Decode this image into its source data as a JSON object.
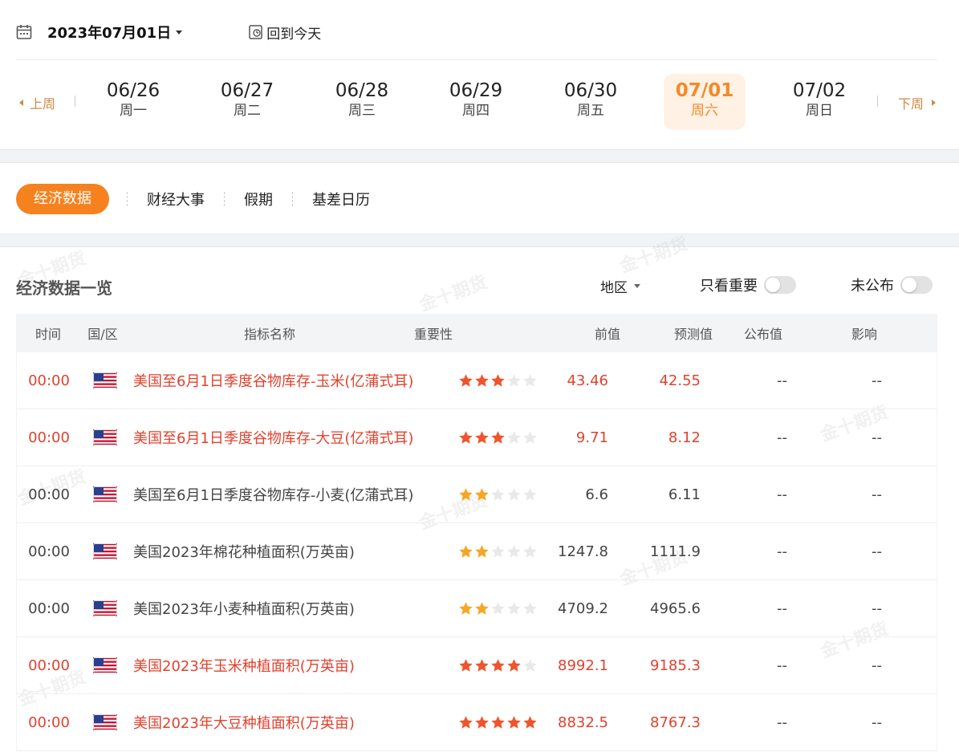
{
  "header": {
    "date": "2023年07月01日",
    "today_label": "回到今天"
  },
  "week": {
    "prev_label": "上周",
    "next_label": "下周",
    "days": [
      {
        "date": "06/26",
        "weekday": "周一"
      },
      {
        "date": "06/27",
        "weekday": "周二"
      },
      {
        "date": "06/28",
        "weekday": "周三"
      },
      {
        "date": "06/29",
        "weekday": "周四"
      },
      {
        "date": "06/30",
        "weekday": "周五"
      },
      {
        "date": "07/01",
        "weekday": "周六"
      },
      {
        "date": "07/02",
        "weekday": "周日"
      }
    ],
    "active_index": 5
  },
  "tabs": [
    "经济数据",
    "财经大事",
    "假期",
    "基差日历"
  ],
  "section": {
    "title": "经济数据一览",
    "region_label": "地区",
    "important_only_label": "只看重要",
    "unpublished_label": "未公布"
  },
  "table": {
    "headers": [
      "时间",
      "国/区",
      "指标名称",
      "重要性",
      "前值",
      "预测值",
      "公布值",
      "影响"
    ],
    "rows": [
      {
        "time": "00:00",
        "flag": "us-flag-icon",
        "name": "美国至6月1日季度谷物库存-玉米(亿蒲式耳)",
        "stars": 3,
        "prev": "43.46",
        "forecast": "42.55",
        "actual": "--",
        "effect": "--",
        "highlight": true
      },
      {
        "time": "00:00",
        "flag": "us-flag-icon",
        "name": "美国至6月1日季度谷物库存-大豆(亿蒲式耳)",
        "stars": 3,
        "prev": "9.71",
        "forecast": "8.12",
        "actual": "--",
        "effect": "--",
        "highlight": true
      },
      {
        "time": "00:00",
        "flag": "us-flag-icon",
        "name": "美国至6月1日季度谷物库存-小麦(亿蒲式耳)",
        "stars": 2,
        "prev": "6.6",
        "forecast": "6.11",
        "actual": "--",
        "effect": "--",
        "highlight": false
      },
      {
        "time": "00:00",
        "flag": "us-flag-icon",
        "name": "美国2023年棉花种植面积(万英亩)",
        "stars": 2,
        "prev": "1247.8",
        "forecast": "1111.9",
        "actual": "--",
        "effect": "--",
        "highlight": false
      },
      {
        "time": "00:00",
        "flag": "us-flag-icon",
        "name": "美国2023年小麦种植面积(万英亩)",
        "stars": 2,
        "prev": "4709.2",
        "forecast": "4965.6",
        "actual": "--",
        "effect": "--",
        "highlight": false
      },
      {
        "time": "00:00",
        "flag": "us-flag-icon",
        "name": "美国2023年玉米种植面积(万英亩)",
        "stars": 4,
        "prev": "8992.1",
        "forecast": "9185.3",
        "actual": "--",
        "effect": "--",
        "highlight": true
      },
      {
        "time": "00:00",
        "flag": "us-flag-icon",
        "name": "美国2023年大豆种植面积(万英亩)",
        "stars": 5,
        "prev": "8832.5",
        "forecast": "8767.3",
        "actual": "--",
        "effect": "--",
        "highlight": true
      }
    ]
  },
  "colors": {
    "accent": "#f6821f",
    "highlight_text": "#e0422e",
    "star_high": "#f0542d",
    "star_low": "#f5a623",
    "star_empty": "#e9e9e9"
  },
  "watermark": "金十期货"
}
